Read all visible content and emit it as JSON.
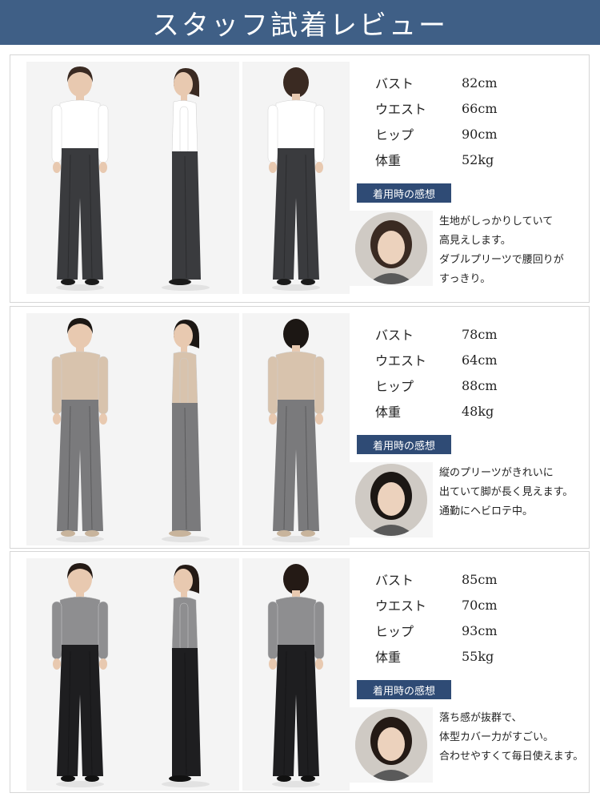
{
  "header": {
    "title": "スタッフ試着レビュー"
  },
  "badge_label": "着用時の感想",
  "reviews": [
    {
      "stats": [
        {
          "label": "バスト",
          "value": "82cm"
        },
        {
          "label": "ウエスト",
          "value": "66cm"
        },
        {
          "label": "ヒップ",
          "value": "90cm"
        },
        {
          "label": "体重",
          "value": "52kg"
        }
      ],
      "comment": [
        "生地がしっかりしていて",
        "高見えします。",
        "ダブルプリーツで腰回りが",
        "すっきり。"
      ],
      "colors": {
        "top": "#ffffff",
        "pants": "#3a3b3e",
        "hair": "#3a2a22",
        "shoes": "#1a1a1a"
      }
    },
    {
      "stats": [
        {
          "label": "バスト",
          "value": "78cm"
        },
        {
          "label": "ウエスト",
          "value": "64cm"
        },
        {
          "label": "ヒップ",
          "value": "88cm"
        },
        {
          "label": "体重",
          "value": "48kg"
        }
      ],
      "comment": [
        "縦のプリーツがきれいに",
        "出ていて脚が長く見えます。",
        "通勤にヘビロテ中。"
      ],
      "colors": {
        "top": "#d8c3ad",
        "pants": "#7a7a7c",
        "hair": "#1c1714",
        "shoes": "#c8b49c"
      }
    },
    {
      "stats": [
        {
          "label": "バスト",
          "value": "85cm"
        },
        {
          "label": "ウエスト",
          "value": "70cm"
        },
        {
          "label": "ヒップ",
          "value": "93cm"
        },
        {
          "label": "体重",
          "value": "55kg"
        }
      ],
      "comment": [
        "落ち感が抜群で、",
        "体型カバー力がすごい。",
        "合わせやすくて毎日使えます。"
      ],
      "colors": {
        "top": "#8e8e90",
        "pants": "#1e1e20",
        "hair": "#241a15",
        "shoes": "#111111"
      }
    }
  ]
}
